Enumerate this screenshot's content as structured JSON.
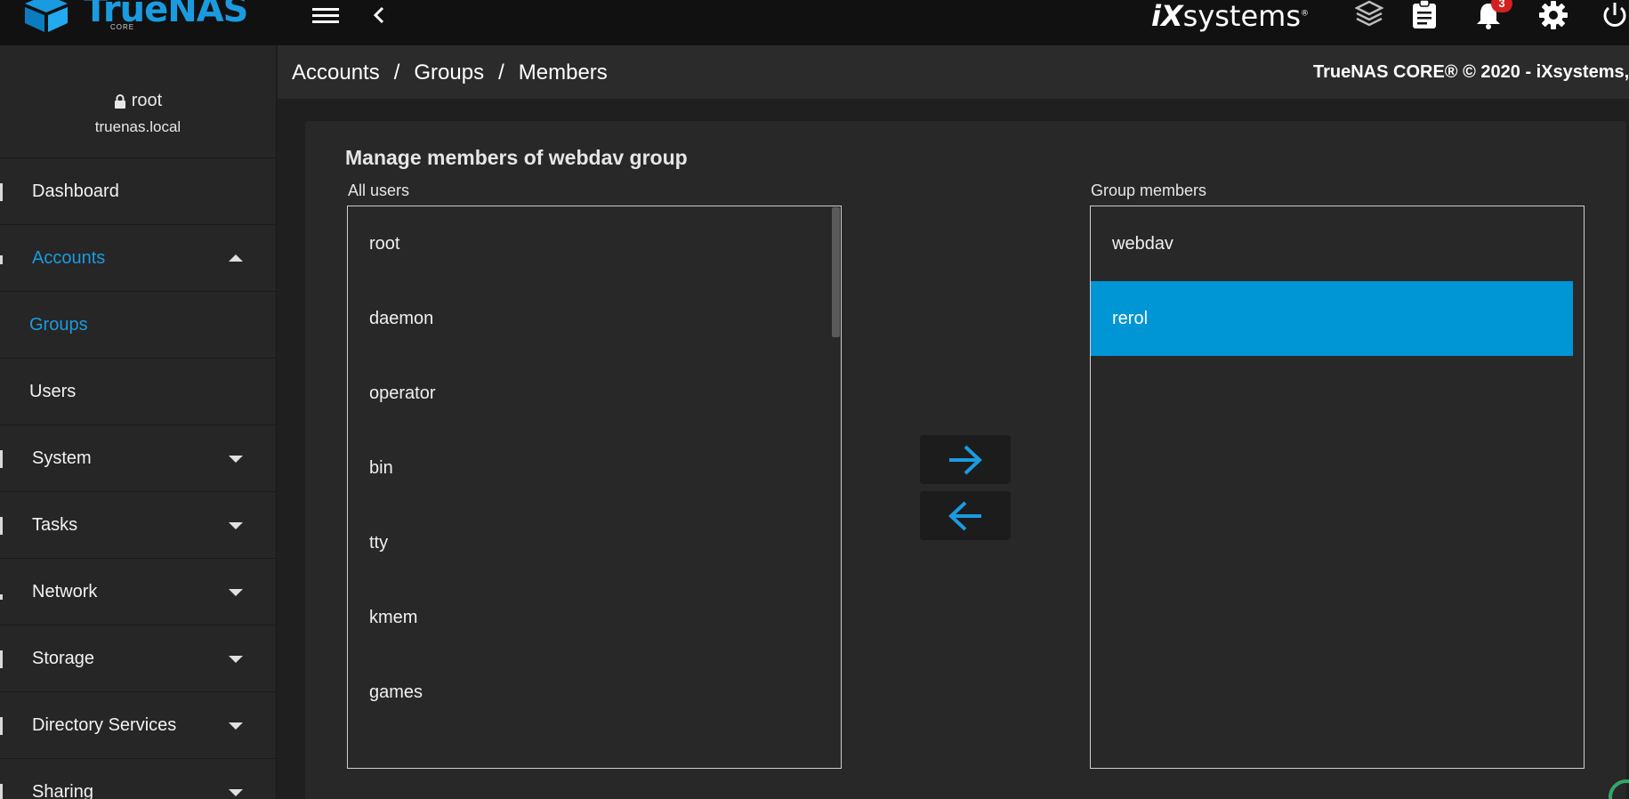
{
  "topbar": {
    "logo_text": "TrueNAS",
    "logo_sub": "CORE",
    "vendor_logo_ix": "iX",
    "vendor_logo_text": "systems",
    "vendor_logo_mark": "®",
    "notification_count": "3",
    "icons": [
      "menu-icon",
      "chevron-left-icon",
      "truecommand-icon",
      "clipboard-icon",
      "bell-icon",
      "gear-icon",
      "power-icon"
    ]
  },
  "sidebar": {
    "user": "root",
    "host": "truenas.local",
    "items": [
      {
        "label": "Dashboard"
      },
      {
        "label": "Accounts"
      },
      {
        "label": "Groups"
      },
      {
        "label": "Users"
      },
      {
        "label": "System"
      },
      {
        "label": "Tasks"
      },
      {
        "label": "Network"
      },
      {
        "label": "Storage"
      },
      {
        "label": "Directory Services"
      },
      {
        "label": "Sharing"
      }
    ]
  },
  "breadcrumb": {
    "items": [
      "Accounts",
      "Groups",
      "Members"
    ],
    "separator": "/"
  },
  "copyright": "TrueNAS CORE® © 2020 - iXsystems,",
  "main": {
    "title": "Manage members of webdav group",
    "all_users_label": "All users",
    "group_members_label": "Group members",
    "all_users": [
      "root",
      "daemon",
      "operator",
      "bin",
      "tty",
      "kmem",
      "games"
    ],
    "group_members": [
      "webdav",
      "rerol"
    ],
    "selected_member": "rerol"
  },
  "colors": {
    "accent": "#1a9be0",
    "selected": "#0095d5",
    "badge": "#d42020"
  }
}
